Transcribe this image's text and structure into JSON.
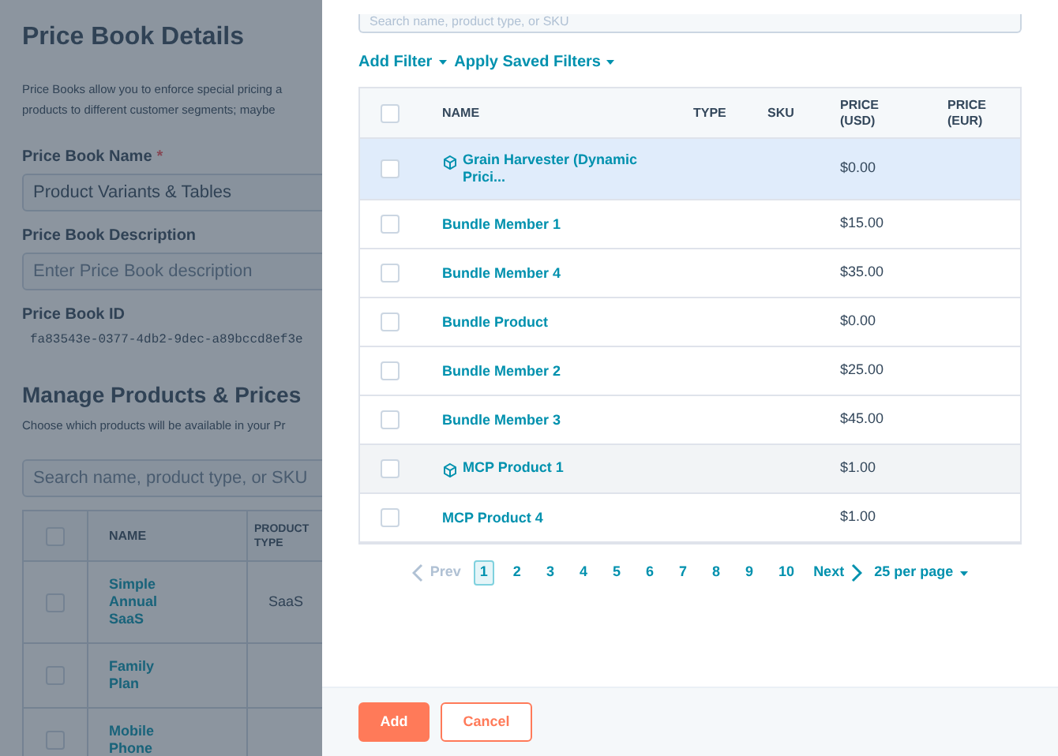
{
  "background_page": {
    "title": "Price Book Details",
    "intro": [
      "Price Books allow you to enforce special pricing a",
      "products to different customer segments; maybe"
    ],
    "name_field": {
      "label": "Price Book Name",
      "required_mark": "*",
      "value": "Product Variants & Tables"
    },
    "description_field": {
      "label": "Price Book Description",
      "placeholder": "Enter Price Book description"
    },
    "id_field": {
      "label": "Price Book ID",
      "value": "fa83543e-0377-4db2-9dec-a89bccd8ef3e"
    },
    "products_section": {
      "title": "Manage Products & Prices",
      "subtitle": "Choose which products will be available in your Pr",
      "search": {
        "placeholder": "Search name, product type, or SKU"
      },
      "table": {
        "select_all_checked": false,
        "columns": [
          "NAME",
          "PRODUCT TYPE"
        ],
        "rows": [
          {
            "checked": false,
            "name": "Simple Annual SaaS",
            "type": "SaaS"
          },
          {
            "checked": false,
            "name": "Family Plan",
            "type": ""
          },
          {
            "checked": false,
            "name": "Mobile Phone",
            "type": ""
          }
        ]
      }
    }
  },
  "panel": {
    "search": {
      "placeholder": "Search name, product type, or SKU"
    },
    "filters": [
      "Add Filter",
      "Apply Saved Filters"
    ],
    "table": {
      "select_all_checked": false,
      "columns": [
        "NAME",
        "TYPE",
        "SKU",
        "PRICE (USD)",
        "PRICE (EUR)"
      ],
      "rows": [
        {
          "checked": false,
          "selected": true,
          "hovered": false,
          "variants": true,
          "name": "Grain Harvester (Dynamic Prici...",
          "price_usd": "$0.00"
        },
        {
          "checked": false,
          "selected": false,
          "hovered": false,
          "variants": false,
          "name": "Bundle Member 1",
          "price_usd": "$15.00"
        },
        {
          "checked": false,
          "selected": false,
          "hovered": false,
          "variants": false,
          "name": "Bundle Member 4",
          "price_usd": "$35.00"
        },
        {
          "checked": false,
          "selected": false,
          "hovered": false,
          "variants": false,
          "name": "Bundle Product",
          "price_usd": "$0.00"
        },
        {
          "checked": false,
          "selected": false,
          "hovered": false,
          "variants": false,
          "name": "Bundle Member 2",
          "price_usd": "$25.00"
        },
        {
          "checked": false,
          "selected": false,
          "hovered": false,
          "variants": false,
          "name": "Bundle Member 3",
          "price_usd": "$45.00"
        },
        {
          "checked": false,
          "selected": false,
          "hovered": true,
          "variants": true,
          "name": "MCP Product 1",
          "price_usd": "$1.00"
        },
        {
          "checked": false,
          "selected": false,
          "hovered": false,
          "variants": false,
          "name": "MCP Product 4",
          "price_usd": "$1.00"
        }
      ]
    },
    "pagination": {
      "prev": {
        "label": "Prev",
        "disabled": true
      },
      "pages": [
        {
          "label": "1",
          "selected": true
        },
        {
          "label": "2",
          "selected": false
        },
        {
          "label": "3",
          "selected": false
        },
        {
          "label": "4",
          "selected": false
        },
        {
          "label": "5",
          "selected": false
        },
        {
          "label": "6",
          "selected": false
        },
        {
          "label": "7",
          "selected": false
        },
        {
          "label": "8",
          "selected": false
        },
        {
          "label": "9",
          "selected": false
        },
        {
          "label": "10",
          "selected": false
        }
      ],
      "next": {
        "label": "Next",
        "disabled": false
      },
      "per_page": "25 per page"
    },
    "buttons": [
      {
        "label": "Add",
        "kind": "primary"
      },
      {
        "label": "Cancel",
        "kind": "secondary"
      }
    ]
  }
}
